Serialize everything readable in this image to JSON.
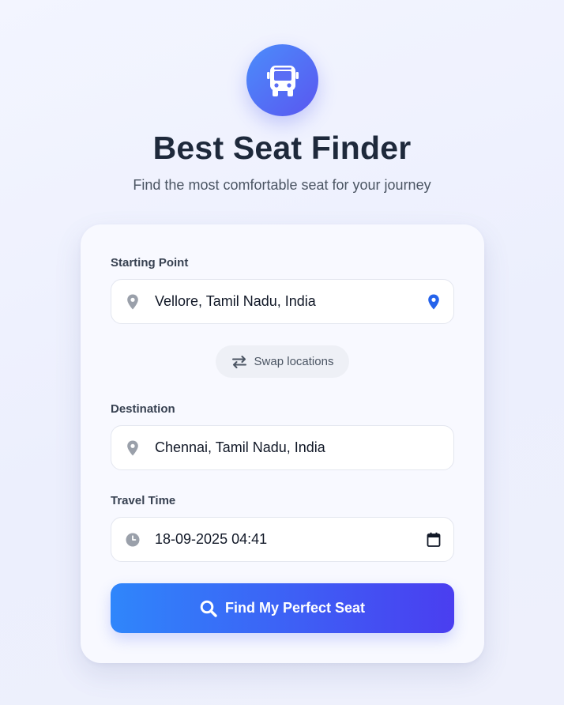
{
  "app": {
    "title": "Best Seat Finder",
    "subtitle": "Find the most comfortable seat for your journey",
    "logo_icon": "bus-icon"
  },
  "form": {
    "start": {
      "label": "Starting Point",
      "value": "Vellore, Tamil Nadu, India",
      "icon": "map-pin-icon",
      "action_icon": "location-pin-icon"
    },
    "swap": {
      "label": "Swap locations",
      "icon": "swap-arrows-icon"
    },
    "destination": {
      "label": "Destination",
      "value": "Chennai, Tamil Nadu, India",
      "icon": "map-pin-icon"
    },
    "time": {
      "label": "Travel Time",
      "value": "18-09-2025 04:41",
      "icon": "clock-icon",
      "picker_icon": "calendar-icon"
    },
    "submit": {
      "label": "Find My Perfect Seat",
      "icon": "search-icon"
    }
  },
  "colors": {
    "accent_start": "#2f86fb",
    "accent_end": "#4a3ef0",
    "pin_accent": "#2563eb",
    "title": "#1e293b"
  }
}
